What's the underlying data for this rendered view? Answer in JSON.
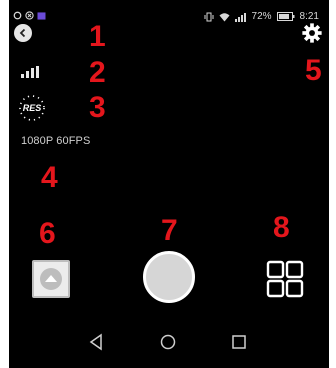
{
  "status_bar": {
    "battery_percent": "72%",
    "time": "8:21",
    "left_icons": [
      "location-icon",
      "x-circle-icon",
      "notification-icon"
    ],
    "right_icons": [
      "vibrate-icon",
      "wifi-icon",
      "cell-signal-icon",
      "battery-icon"
    ]
  },
  "camera": {
    "resolution_badge": "RES",
    "resolution_text": "1080P 60FPS"
  },
  "callouts": [
    "1",
    "2",
    "3",
    "4",
    "5",
    "6",
    "7",
    "8"
  ],
  "colors": {
    "background": "#000000",
    "callout": "#e4161c",
    "shutter": "#d6d6d6"
  },
  "nav": [
    "back-triangle-icon",
    "home-circle-icon",
    "recents-square-icon"
  ]
}
